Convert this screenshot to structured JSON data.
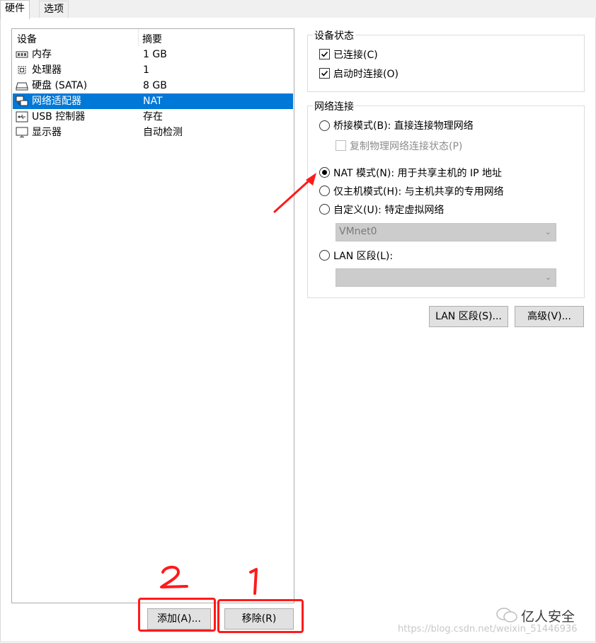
{
  "tabs": [
    {
      "label": "硬件",
      "active": true
    },
    {
      "label": "选项",
      "active": false
    }
  ],
  "device_list": {
    "headers": {
      "device": "设备",
      "summary": "摘要"
    },
    "rows": [
      {
        "icon": "memory-icon",
        "name": "内存",
        "summary": "1 GB",
        "selected": false
      },
      {
        "icon": "processor-icon",
        "name": "处理器",
        "summary": "1",
        "selected": false
      },
      {
        "icon": "harddisk-icon",
        "name": "硬盘 (SATA)",
        "summary": "8 GB",
        "selected": false
      },
      {
        "icon": "network-adapter-icon",
        "name": "网络适配器",
        "summary": "NAT",
        "selected": true
      },
      {
        "icon": "usb-controller-icon",
        "name": "USB 控制器",
        "summary": "存在",
        "selected": false
      },
      {
        "icon": "display-icon",
        "name": "显示器",
        "summary": "自动检测",
        "selected": false
      }
    ]
  },
  "device_status": {
    "title": "设备状态",
    "connected": {
      "label": "已连接(C)",
      "checked": true
    },
    "connect_at_power_on": {
      "label": "启动时连接(O)",
      "checked": true
    }
  },
  "network_connection": {
    "title": "网络连接",
    "bridged": {
      "label": "桥接模式(B): 直接连接物理网络",
      "selected": false
    },
    "replicate": {
      "label": "复制物理网络连接状态(P)",
      "checked": false,
      "disabled": true
    },
    "nat": {
      "label": "NAT 模式(N): 用于共享主机的 IP 地址",
      "selected": true
    },
    "host_only": {
      "label": "仅主机模式(H): 与主机共享的专用网络",
      "selected": false
    },
    "custom": {
      "label": "自定义(U): 特定虚拟网络",
      "selected": false
    },
    "custom_network_value": "VMnet0",
    "lan_segment": {
      "label": "LAN 区段(L):",
      "selected": false
    },
    "lan_segment_value": ""
  },
  "buttons": {
    "lan_segments": "LAN 区段(S)...",
    "advanced": "高级(V)...",
    "add": "添加(A)...",
    "remove": "移除(R)"
  },
  "annotations": {
    "mark_add": "2",
    "mark_remove": "1",
    "highlight_color": "#ff1a1a"
  },
  "watermark": {
    "brand": "亿人安全",
    "url": "https://blog.csdn.net/weixin_51446936"
  },
  "colors": {
    "selection": "#0078d7",
    "annotation": "#ff1a1a"
  }
}
